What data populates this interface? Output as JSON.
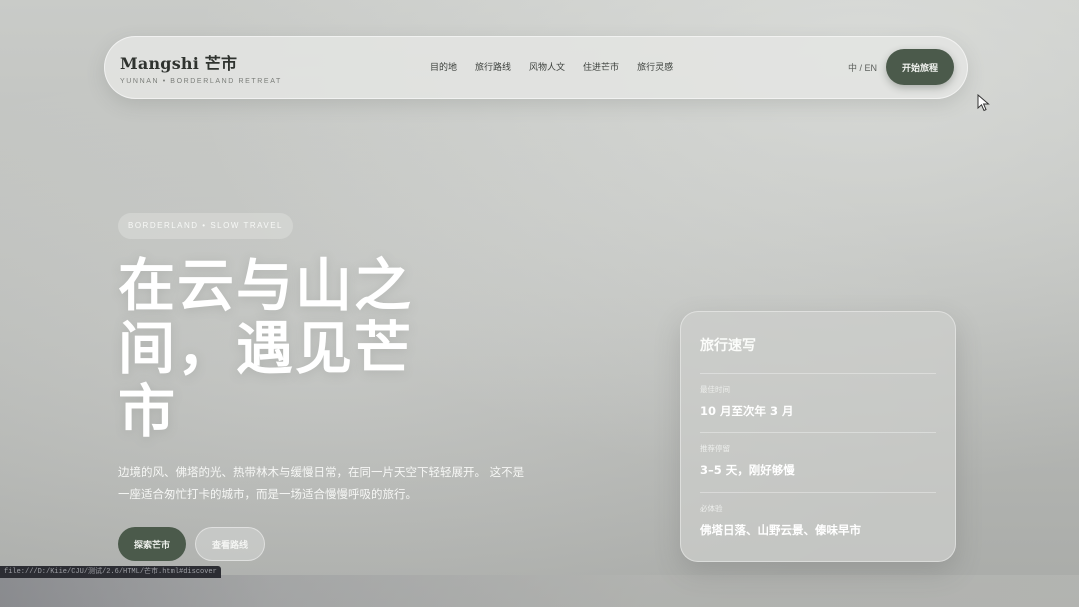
{
  "nav": {
    "brand_title": "Mangshi 芒市",
    "brand_sub": "YUNNAN  •  BORDERLAND RETREAT",
    "links": [
      "目的地",
      "旅行路线",
      "风物人文",
      "住进芒市",
      "旅行灵感"
    ],
    "lang": "中 / EN",
    "cta": "开始旅程"
  },
  "hero": {
    "badge": "BORDERLAND  •  SLOW TRAVEL",
    "title": "在云与山之间，遇见芒市",
    "description": "边境的风、佛塔的光、热带林木与缓慢日常，在同一片天空下轻轻展开。 这不是一座适合匆忙打卡的城市，而是一场适合慢慢呼吸的旅行。",
    "primary_button": "探索芒市",
    "secondary_button": "查看路线"
  },
  "card": {
    "title": "旅行速写",
    "rows": [
      {
        "label": "最佳时间",
        "value": "10 月至次年 3 月"
      },
      {
        "label": "推荐停留",
        "value": "3–5 天，刚好够慢"
      },
      {
        "label": "必体验",
        "value": "佛塔日落、山野云景、傣味早市"
      }
    ]
  },
  "status_bar": {
    "url": "file:///D:/Kiie/CJU/测试/2.6/HTML/芒市.html#discover"
  },
  "colors": {
    "accent": "#4b5a4b",
    "background": "#bfc1be"
  }
}
